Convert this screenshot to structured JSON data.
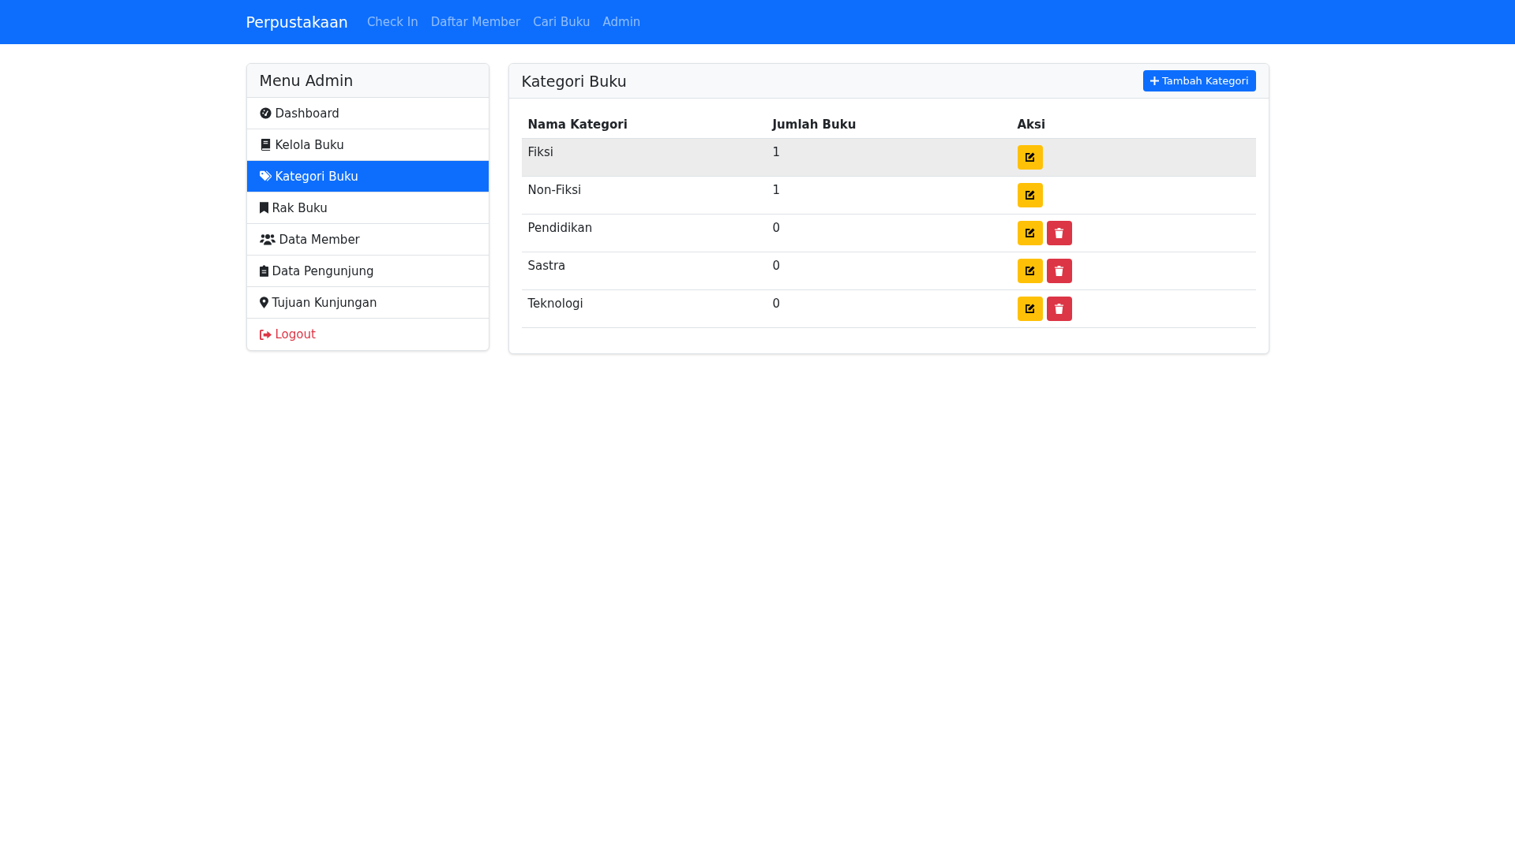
{
  "navbar": {
    "brand": "Perpustakaan",
    "links": [
      {
        "label": "Check In",
        "selected": false
      },
      {
        "label": "Daftar Member",
        "selected": false
      },
      {
        "label": "Cari Buku",
        "selected": false
      },
      {
        "label": "Admin",
        "selected": false
      }
    ]
  },
  "sidebar": {
    "title": "Menu Admin",
    "items": [
      {
        "label": "Dashboard",
        "selected": false,
        "kind": "link"
      },
      {
        "label": "Kelola Buku",
        "selected": false,
        "kind": "link"
      },
      {
        "label": "Kategori Buku",
        "selected": true,
        "kind": "link"
      },
      {
        "label": "Rak Buku",
        "selected": false,
        "kind": "link"
      },
      {
        "label": "Data Member",
        "selected": false,
        "kind": "link"
      },
      {
        "label": "Data Pengunjung",
        "selected": false,
        "kind": "link"
      },
      {
        "label": "Tujuan Kunjungan",
        "selected": false,
        "kind": "link"
      },
      {
        "label": "Logout",
        "selected": false,
        "kind": "danger"
      }
    ]
  },
  "panel": {
    "title": "Kategori Buku",
    "add_button": "Tambah Kategori",
    "table": {
      "columns": [
        "Nama Kategori",
        "Jumlah Buku",
        "Aksi"
      ],
      "rows": [
        {
          "name": "Fiksi",
          "count": "1",
          "highlighted": true,
          "deletable": false
        },
        {
          "name": "Non-Fiksi",
          "count": "1",
          "highlighted": false,
          "deletable": false
        },
        {
          "name": "Pendidikan",
          "count": "0",
          "highlighted": false,
          "deletable": true
        },
        {
          "name": "Sastra",
          "count": "0",
          "highlighted": false,
          "deletable": true
        },
        {
          "name": "Teknologi",
          "count": "0",
          "highlighted": false,
          "deletable": true
        }
      ]
    }
  }
}
